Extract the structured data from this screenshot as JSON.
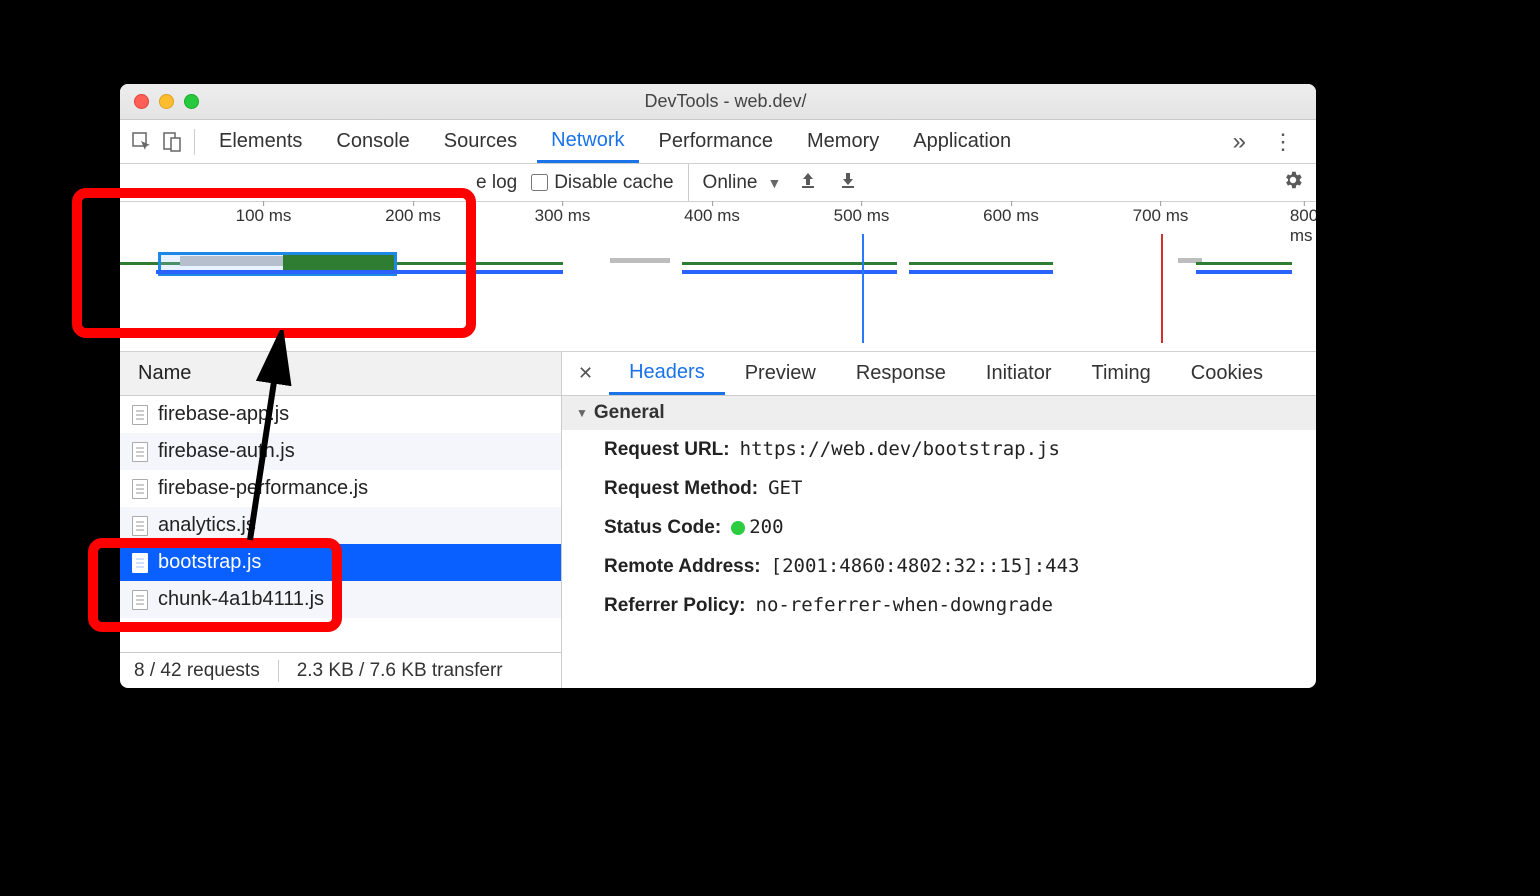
{
  "window": {
    "title": "DevTools - web.dev/"
  },
  "tabs": {
    "elements": "Elements",
    "console": "Console",
    "sources": "Sources",
    "network": "Network",
    "performance": "Performance",
    "memory": "Memory",
    "application": "Application"
  },
  "toolbar": {
    "preserve_log": "e log",
    "disable_cache": "Disable cache",
    "throttling": "Online"
  },
  "overview": {
    "ticks": [
      "100 ms",
      "200 ms",
      "300 ms",
      "400 ms",
      "500 ms",
      "600 ms",
      "700 ms",
      "800 ms"
    ]
  },
  "request_list": {
    "header": "Name",
    "rows": [
      {
        "name": "firebase-app.js",
        "selected": false
      },
      {
        "name": "firebase-auth.js",
        "selected": false
      },
      {
        "name": "firebase-performance.js",
        "selected": false
      },
      {
        "name": "analytics.js",
        "selected": false
      },
      {
        "name": "bootstrap.js",
        "selected": true
      },
      {
        "name": "chunk-4a1b4111.js",
        "selected": false
      }
    ]
  },
  "status": {
    "requests": "8 / 42 requests",
    "transferred": "2.3 KB / 7.6 KB transferr"
  },
  "detail_tabs": {
    "headers": "Headers",
    "preview": "Preview",
    "response": "Response",
    "initiator": "Initiator",
    "timing": "Timing",
    "cookies": "Cookies"
  },
  "general": {
    "section": "General",
    "request_url_k": "Request URL:",
    "request_url_v": "https://web.dev/bootstrap.js",
    "request_method_k": "Request Method:",
    "request_method_v": "GET",
    "status_code_k": "Status Code:",
    "status_code_v": "200",
    "remote_address_k": "Remote Address:",
    "remote_address_v": "[2001:4860:4802:32::15]:443",
    "referrer_policy_k": "Referrer Policy:",
    "referrer_policy_v": "no-referrer-when-downgrade"
  }
}
